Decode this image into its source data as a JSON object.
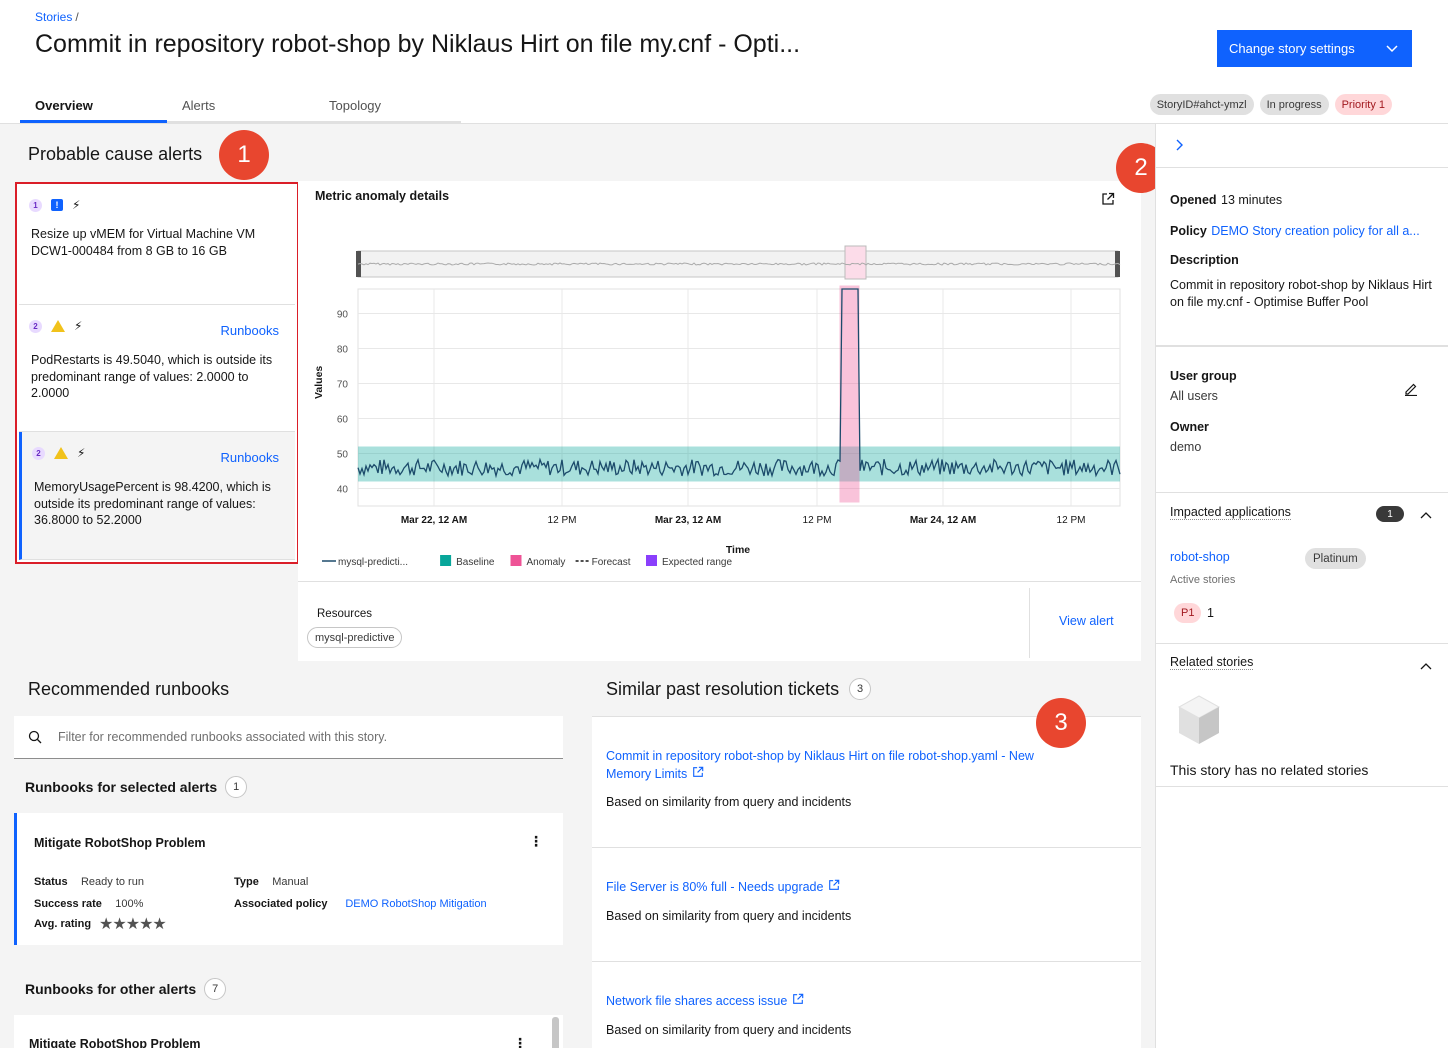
{
  "breadcrumb": {
    "root": "Stories",
    "sep": "/"
  },
  "title": "Commit in repository robot-shop by Niklaus Hirt on file my.cnf - Opti...",
  "settings_button": "Change story settings",
  "tabs": [
    {
      "label": "Overview",
      "active": true
    },
    {
      "label": "Alerts",
      "active": false
    },
    {
      "label": "Topology",
      "active": false
    }
  ],
  "tags": {
    "story_id": "StoryID#ahct-ymzl",
    "status": "In progress",
    "priority": "Priority 1"
  },
  "probable_cause": {
    "title": "Probable cause alerts",
    "alerts": [
      {
        "rank": "1",
        "severity": "info",
        "runbooks": "",
        "text": "Resize up vMEM for Virtual Machine VM DCW1-000484 from 8 GB to 16 GB"
      },
      {
        "rank": "2",
        "severity": "warning",
        "runbooks": "Runbooks",
        "text": "PodRestarts is 49.5040, which is outside its predominant range of values: 2.0000 to 2.0000"
      },
      {
        "rank": "2",
        "severity": "warning",
        "runbooks": "Runbooks",
        "text": "MemoryUsagePercent is 98.4200, which is outside its predominant range of values: 36.8000 to 52.2000"
      }
    ]
  },
  "annotations": [
    "1",
    "2",
    "3"
  ],
  "metric": {
    "title": "Metric anomaly details",
    "ylabel": "Values",
    "xlabel": "Time",
    "yticks": [
      "90",
      "80",
      "70",
      "60",
      "50",
      "40"
    ],
    "xticks": [
      "Mar 22, 12 AM",
      "12 PM",
      "Mar 23, 12 AM",
      "12 PM",
      "Mar 24, 12 AM",
      "12 PM"
    ],
    "legend": [
      {
        "label": "mysql-predicti...",
        "kind": "line",
        "color": "#1c4b6b"
      },
      {
        "label": "Baseline",
        "kind": "box",
        "color": "#08a69a"
      },
      {
        "label": "Anomaly",
        "kind": "box",
        "color": "#ee5396"
      },
      {
        "label": "Forecast",
        "kind": "dash",
        "color": "#161616"
      },
      {
        "label": "Expected range",
        "kind": "box",
        "color": "#8a3ffc"
      }
    ],
    "resources_label": "Resources",
    "resource": "mysql-predictive",
    "view_alert": "View alert"
  },
  "chart_data": {
    "type": "line",
    "xlabel": "Time",
    "ylabel": "Values",
    "ylim": [
      35,
      97
    ],
    "series": [
      {
        "name": "mysql-predicti...",
        "baseline_mean": 46,
        "noise": 1.2,
        "spike_value": 98.4,
        "spike_at_fraction": 0.645
      }
    ],
    "baseline_band": [
      42,
      52
    ],
    "anomaly_band": [
      36,
      98
    ]
  },
  "runbooks": {
    "title": "Recommended runbooks",
    "search_placeholder": "Filter for recommended runbooks associated with this story.",
    "selected_header": "Runbooks for selected alerts",
    "selected_count": "1",
    "other_header": "Runbooks for other alerts",
    "other_count": "7",
    "card": {
      "title": "Mitigate RobotShop Problem",
      "status_k": "Status",
      "status_v": "Ready to run",
      "type_k": "Type",
      "type_v": "Manual",
      "success_k": "Success rate",
      "success_v": "100%",
      "policy_k": "Associated policy",
      "policy_v": "DEMO RobotShop Mitigation",
      "rating_k": "Avg. rating",
      "stars": "★★★★★",
      "rating_value": 5
    },
    "card2_title": "Mitigate RobotShop Problem"
  },
  "tickets": {
    "title": "Similar past resolution tickets",
    "count": "3",
    "items": [
      {
        "link1": "Commit in repository robot-shop by Niklaus Hirt on file robot-shop.yaml - New",
        "link2": "Memory Limits",
        "sub": "Based on similarity from query and incidents"
      },
      {
        "link1": "File Server is 80% full - Needs upgrade",
        "link2": "",
        "sub": "Based on similarity from query and incidents"
      },
      {
        "link1": "Network file shares access issue",
        "link2": "",
        "sub": "Based on similarity from query and incidents"
      }
    ]
  },
  "side": {
    "opened_k": "Opened",
    "opened_v": "13 minutes",
    "policy_k": "Policy",
    "policy_v": "DEMO Story creation policy for all a...",
    "desc_k": "Description",
    "desc_v": "Commit in repository robot-shop by Niklaus Hirt on file my.cnf - Optimise Buffer Pool",
    "usergroup_k": "User group",
    "usergroup_v": "All users",
    "owner_k": "Owner",
    "owner_v": "demo",
    "impacted_title": "Impacted applications",
    "impacted_count": "1",
    "app_name": "robot-shop",
    "app_tier": "Platinum",
    "active_stories": "Active stories",
    "p1": "P1",
    "p1_count": "1",
    "related_title": "Related stories",
    "related_empty": "This story has no related stories"
  }
}
